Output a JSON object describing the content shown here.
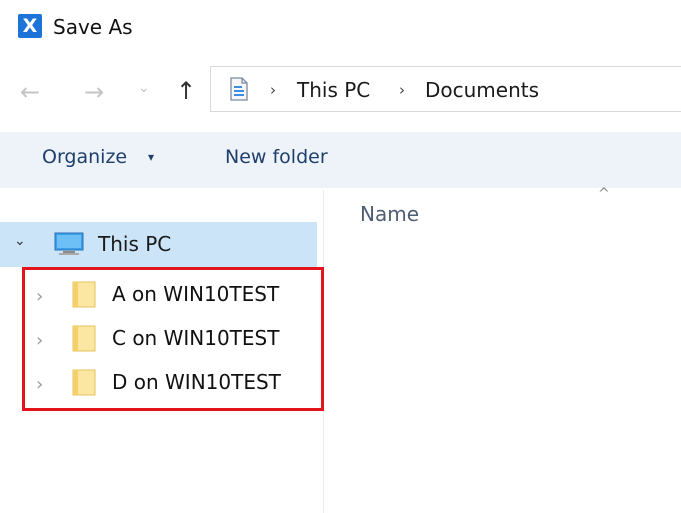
{
  "window": {
    "title": "Save As",
    "app_icon_letter": "X",
    "app_icon_color": "#1e73d8"
  },
  "address_bar": {
    "back_icon": "←",
    "forward_icon": "→",
    "recent_icon": "⌄",
    "up_icon": "↑",
    "separator": "›",
    "breadcrumbs": [
      "This PC",
      "Documents"
    ]
  },
  "toolbar": {
    "organize_label": "Organize",
    "organize_caret": "▾",
    "new_folder_label": "New folder",
    "background": "#eef3fa"
  },
  "nav_pane": {
    "root": {
      "label": "This PC",
      "expanded": true,
      "selected": true,
      "chevron": "⌄"
    },
    "drives": [
      {
        "label": "A on WIN10TEST",
        "chevron": "›"
      },
      {
        "label": "C on WIN10TEST",
        "chevron": "›"
      },
      {
        "label": "D on WIN10TEST",
        "chevron": "›"
      }
    ],
    "selection_color": "#cce4f7",
    "highlight_color": "#e3141b"
  },
  "file_list": {
    "sort_arrow": "^",
    "columns": [
      "Name"
    ]
  }
}
